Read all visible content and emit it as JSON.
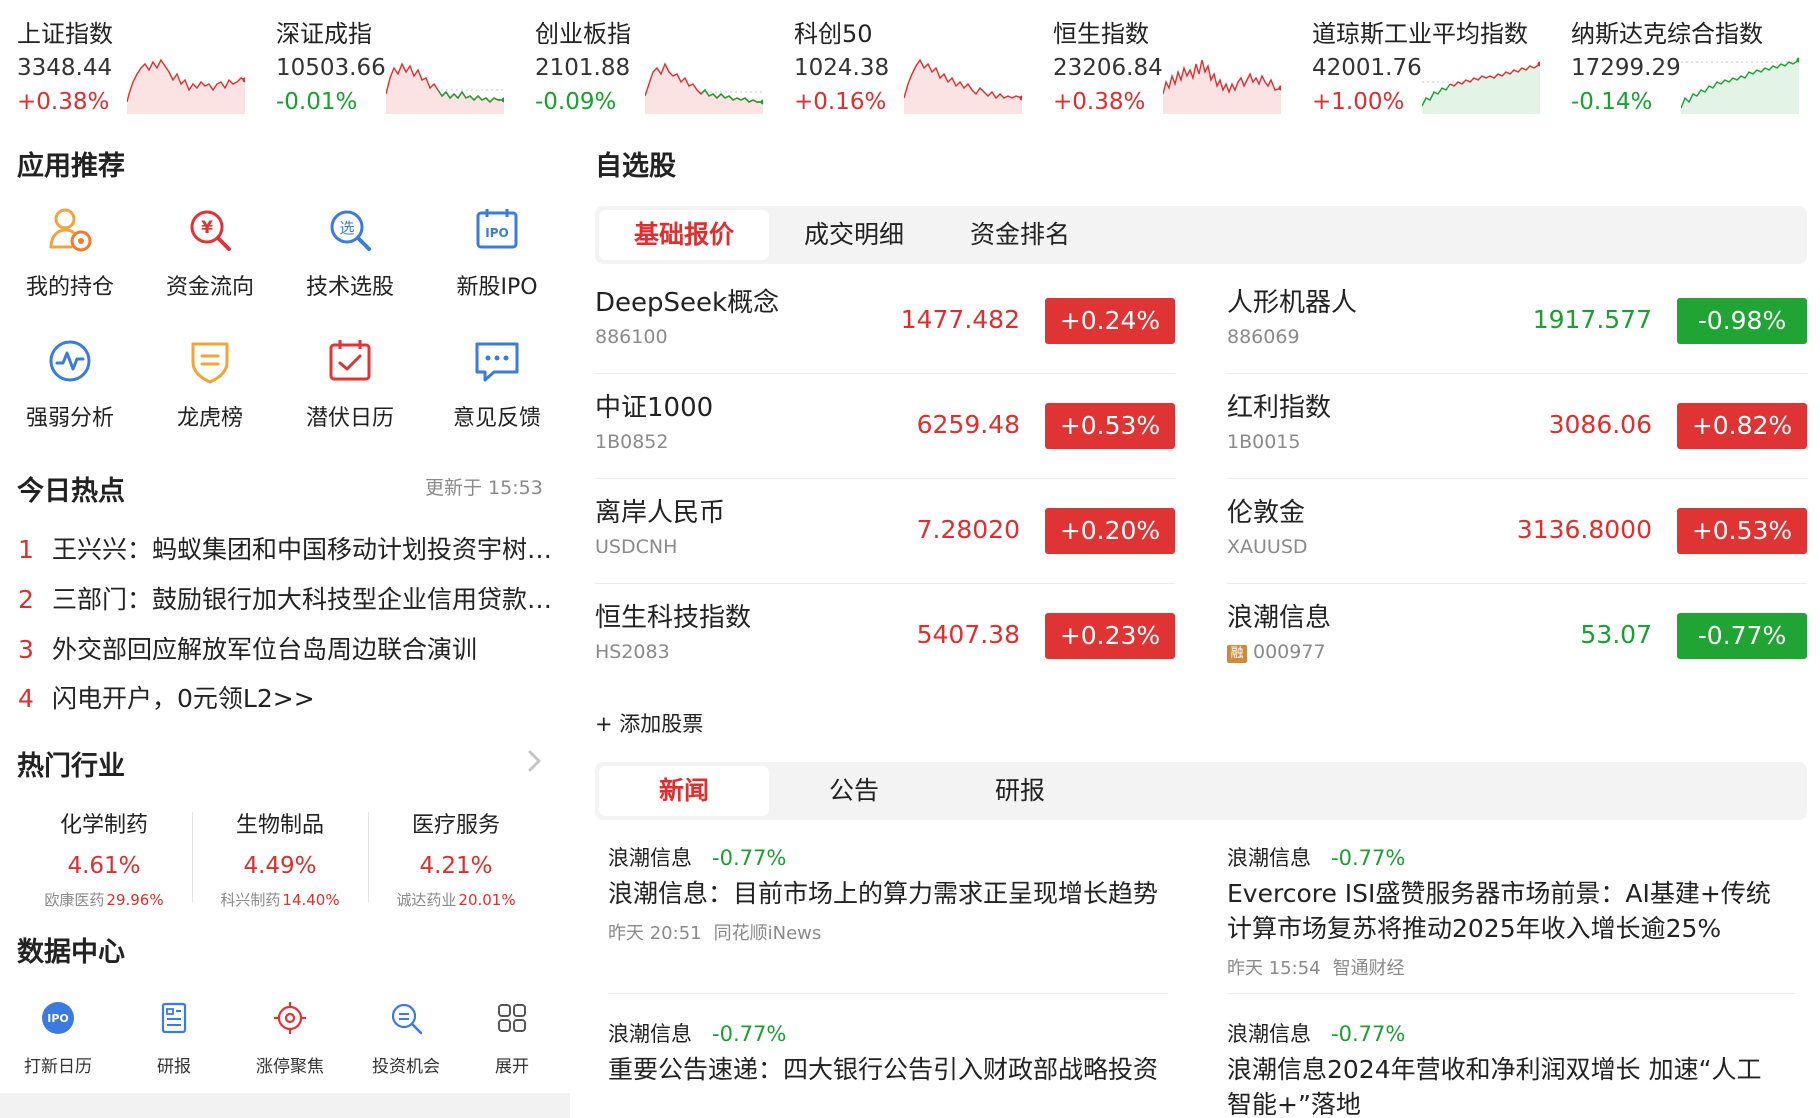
{
  "indices": [
    {
      "name": "上证指数",
      "value": "3348.44",
      "change": "+0.38%",
      "trend": "up",
      "color": "#e02e2e"
    },
    {
      "name": "深证成指",
      "value": "10503.66",
      "change": "-0.01%",
      "trend": "down",
      "color": "#19a030"
    },
    {
      "name": "创业板指",
      "value": "2101.88",
      "change": "-0.09%",
      "trend": "down",
      "color": "#19a030"
    },
    {
      "name": "科创50",
      "value": "1024.38",
      "change": "+0.16%",
      "trend": "up",
      "color": "#e02e2e"
    },
    {
      "name": "恒生指数",
      "value": "23206.84",
      "change": "+0.38%",
      "trend": "up",
      "color": "#e02e2e"
    },
    {
      "name": "道琼斯工业平均指数",
      "value": "42001.76",
      "change": "+1.00%",
      "trend": "up",
      "color": "#e02e2e"
    },
    {
      "name": "纳斯达克综合指数",
      "value": "17299.29",
      "change": "-0.14%",
      "trend": "down",
      "color": "#19a030"
    }
  ],
  "apps": {
    "title": "应用推荐",
    "items": [
      {
        "label": "我的持仓",
        "icon": "holdings-icon"
      },
      {
        "label": "资金流向",
        "icon": "money-flow-icon"
      },
      {
        "label": "技术选股",
        "icon": "stock-select-icon"
      },
      {
        "label": "新股IPO",
        "icon": "ipo-icon"
      },
      {
        "label": "强弱分析",
        "icon": "strength-analysis-icon"
      },
      {
        "label": "龙虎榜",
        "icon": "dragon-tiger-icon"
      },
      {
        "label": "潜伏日历",
        "icon": "calendar-icon"
      },
      {
        "label": "意见反馈",
        "icon": "feedback-icon"
      }
    ]
  },
  "hot": {
    "title": "今日热点",
    "updated": "更新于 15:53",
    "items": [
      {
        "rank": "1",
        "text": "王兴兴：蚂蚁集团和中国移动计划投资宇树科技"
      },
      {
        "rank": "2",
        "text": "三部门：鼓励银行加大科技型企业信用贷款投放"
      },
      {
        "rank": "3",
        "text": "外交部回应解放军位台岛周边联合演训"
      },
      {
        "rank": "4",
        "text": "闪电开户，0元领L2>>"
      }
    ]
  },
  "industry": {
    "title": "热门行业",
    "items": [
      {
        "name": "化学制药",
        "pct": "4.61%",
        "leader": "欧康医药",
        "leader_pct": "29.96%"
      },
      {
        "name": "生物制品",
        "pct": "4.49%",
        "leader": "科兴制药",
        "leader_pct": "14.40%"
      },
      {
        "name": "医疗服务",
        "pct": "4.21%",
        "leader": "诚达药业",
        "leader_pct": "20.01%"
      }
    ]
  },
  "data_center": {
    "title": "数据中心",
    "items": [
      {
        "label": "打新日历",
        "icon": "ipo-calendar-icon"
      },
      {
        "label": "研报",
        "icon": "research-report-icon"
      },
      {
        "label": "涨停聚焦",
        "icon": "limit-up-focus-icon"
      },
      {
        "label": "投资机会",
        "icon": "investment-opportunity-icon"
      },
      {
        "label": "展开",
        "icon": "expand-grid-icon"
      }
    ]
  },
  "watchlist": {
    "title": "自选股",
    "tabs": [
      "基础报价",
      "成交明细",
      "资金排名"
    ],
    "active_tab": 0,
    "quotes": [
      {
        "name": "DeepSeek概念",
        "code": "886100",
        "price": "1477.482",
        "change": "+0.24%",
        "dir": "up"
      },
      {
        "name": "人形机器人",
        "code": "886069",
        "price": "1917.577",
        "change": "-0.98%",
        "dir": "down"
      },
      {
        "name": "中证1000",
        "code": "1B0852",
        "price": "6259.48",
        "change": "+0.53%",
        "dir": "up"
      },
      {
        "name": "红利指数",
        "code": "1B0015",
        "price": "3086.06",
        "change": "+0.82%",
        "dir": "up"
      },
      {
        "name": "离岸人民币",
        "code": "USDCNH",
        "price": "7.28020",
        "change": "+0.20%",
        "dir": "up"
      },
      {
        "name": "伦敦金",
        "code": "XAUUSD",
        "price": "3136.8000",
        "change": "+0.53%",
        "dir": "up"
      },
      {
        "name": "恒生科技指数",
        "code": "HS2083",
        "price": "5407.38",
        "change": "+0.23%",
        "dir": "up"
      },
      {
        "name": "浪潮信息",
        "code": "000977",
        "tag": "融",
        "price": "53.07",
        "change": "-0.77%",
        "dir": "down"
      }
    ],
    "add_label": "+ 添加股票"
  },
  "news": {
    "tabs": [
      "新闻",
      "公告",
      "研报"
    ],
    "active_tab": 0,
    "items": [
      {
        "stock": "浪潮信息",
        "pct": "-0.77%",
        "title": "浪潮信息：目前市场上的算力需求正呈现增长趋势",
        "time": "昨天 20:51",
        "source": "同花顺iNews"
      },
      {
        "stock": "浪潮信息",
        "pct": "-0.77%",
        "title": "Evercore ISI盛赞服务器市场前景：AI基建+传统计算市场复苏将推动2025年收入增长逾25%",
        "time": "昨天 15:54",
        "source": "智通财经"
      },
      {
        "stock": "浪潮信息",
        "pct": "-0.77%",
        "title": "重要公告速递：四大银行公告引入财政部战略投资"
      },
      {
        "stock": "浪潮信息",
        "pct": "-0.77%",
        "title": "浪潮信息2024年营收和净利润双增长 加速“人工智能+”落地"
      }
    ]
  },
  "colors": {
    "up": "#e02e2e",
    "down": "#19a030",
    "badge_up": "#e03434",
    "badge_down": "#20a534"
  }
}
